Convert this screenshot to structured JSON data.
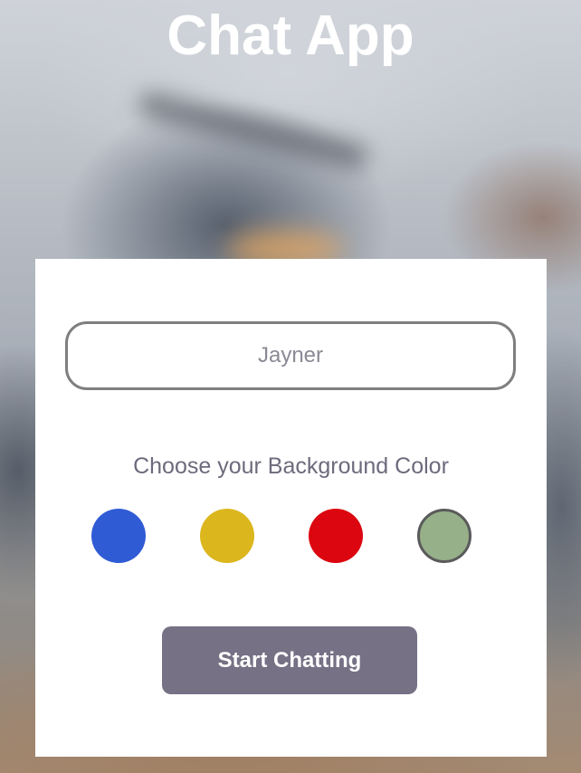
{
  "app": {
    "title": "Chat App"
  },
  "form": {
    "name_value": "",
    "name_placeholder": "Jayner",
    "color_label": "Choose your Background Color",
    "colors": [
      {
        "name": "blue",
        "hex": "#2f5bd5",
        "selected": false
      },
      {
        "name": "yellow",
        "hex": "#dbb61d",
        "selected": false
      },
      {
        "name": "red",
        "hex": "#dc0610",
        "selected": false
      },
      {
        "name": "green",
        "hex": "#96b08a",
        "selected": true
      }
    ],
    "start_label": "Start Chatting",
    "start_color": "#767185"
  }
}
